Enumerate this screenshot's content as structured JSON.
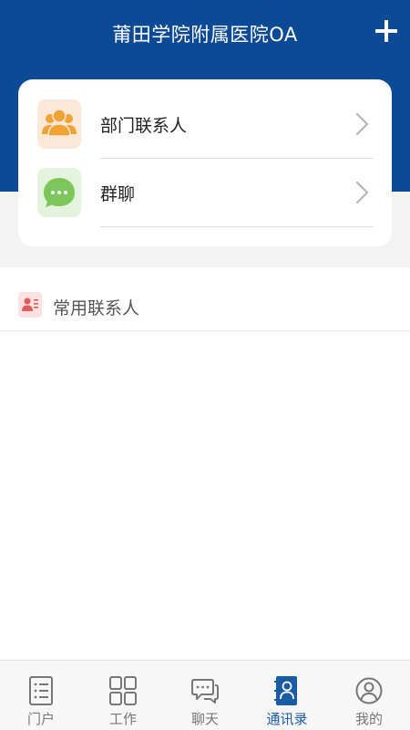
{
  "app": {
    "title": "莆田学院附属医院OA"
  },
  "menu": {
    "items": [
      {
        "label": "部门联系人",
        "icon": "department-contacts-icon"
      },
      {
        "label": "群聊",
        "icon": "group-chat-icon"
      }
    ]
  },
  "frequent": {
    "label": "常用联系人"
  },
  "tabs": [
    {
      "label": "门户",
      "icon": "portal-icon",
      "active": false
    },
    {
      "label": "工作",
      "icon": "work-grid-icon",
      "active": false
    },
    {
      "label": "聊天",
      "icon": "chat-icon",
      "active": false
    },
    {
      "label": "通讯录",
      "icon": "contacts-book-icon",
      "active": true
    },
    {
      "label": "我的",
      "icon": "profile-icon",
      "active": false
    }
  ],
  "colors": {
    "brand": "#0d4a96",
    "active_tab": "#1a5ba6",
    "dept_icon": "#f0a234",
    "group_icon": "#7dc65a"
  }
}
